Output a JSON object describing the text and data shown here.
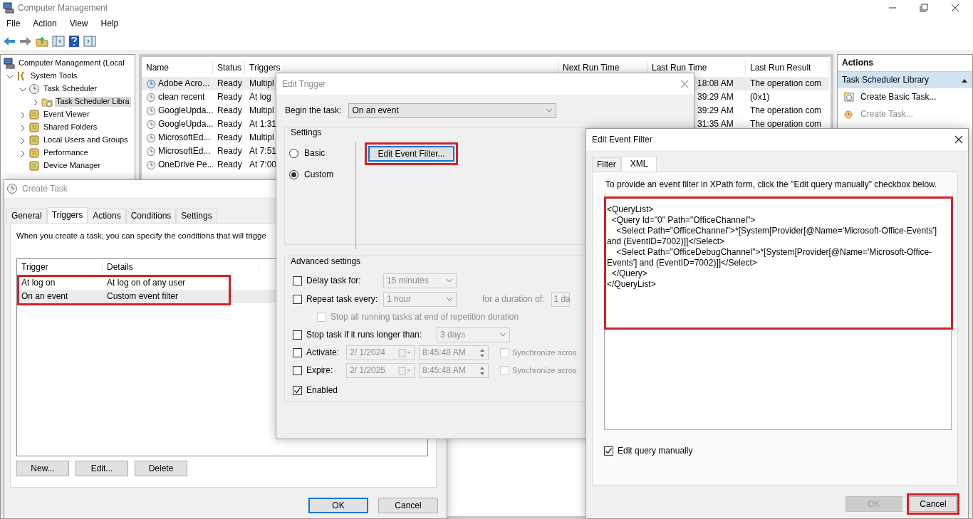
{
  "window": {
    "title": "Computer Management",
    "menu": [
      "File",
      "Action",
      "View",
      "Help"
    ]
  },
  "tree": [
    {
      "label": "Computer Management (Local",
      "selected": false,
      "children": [
        {
          "label": "System Tools",
          "expanded": true,
          "selected": false,
          "children": [
            {
              "label": "Task Scheduler",
              "expanded": true,
              "selected": false,
              "children": [
                {
                  "label": "Task Scheduler Libra",
                  "expanded": false,
                  "selected": true
                }
              ]
            },
            {
              "label": "Event Viewer",
              "expanded": false,
              "selected": false
            },
            {
              "label": "Shared Folders",
              "expanded": false,
              "selected": false
            },
            {
              "label": "Local Users and Groups",
              "expanded": false,
              "selected": false
            },
            {
              "label": "Performance",
              "expanded": false,
              "selected": false
            },
            {
              "label": "Device Manager",
              "selected": false
            }
          ]
        }
      ]
    }
  ],
  "task_list": {
    "columns": [
      "Name",
      "Status",
      "Triggers",
      "Next Run Time",
      "Last Run Time",
      "Last Run Result"
    ],
    "rows": [
      {
        "name": "Adobe Acro...",
        "status": "Ready",
        "triggers": "Multipl",
        "last_run_time": "18:08 AM",
        "last_run_result": "The operation com",
        "selected": true
      },
      {
        "name": "clean recent",
        "status": "Ready",
        "triggers": "At log",
        "last_run_time": "39:29 AM",
        "last_run_result": "(0x1)",
        "selected": false
      },
      {
        "name": "GoogleUpda...",
        "status": "Ready",
        "triggers": "Multipl",
        "last_run_time": "39:29 AM",
        "last_run_result": "The operation com",
        "selected": false
      },
      {
        "name": "GoogleUpda...",
        "status": "Ready",
        "triggers": "At 1:31",
        "last_run_time": "31:35 AM",
        "last_run_result": "The operation com",
        "selected": false
      },
      {
        "name": "MicrosoftEd...",
        "status": "Ready",
        "triggers": "Multipl",
        "selected": false
      },
      {
        "name": "MicrosoftEd...",
        "status": "Ready",
        "triggers": "At 7:51",
        "selected": false
      },
      {
        "name": "OneDrive Pe...",
        "status": "Ready",
        "triggers": "At 7:00",
        "selected": false
      }
    ]
  },
  "actions": {
    "title": "Actions",
    "section": {
      "label": "Task Scheduler Library",
      "expanded": true
    },
    "items": [
      {
        "label": "Create Basic Task...",
        "disabled": false
      },
      {
        "label": "Create Task...",
        "disabled": true
      }
    ]
  },
  "create_task": {
    "title": "Create Task",
    "tabs": [
      {
        "label": "General",
        "selected": false
      },
      {
        "label": "Triggers",
        "selected": true
      },
      {
        "label": "Actions",
        "selected": false
      },
      {
        "label": "Conditions",
        "selected": false
      },
      {
        "label": "Settings",
        "selected": false
      }
    ],
    "intro": "When you create a task, you can specify the conditions that will trigge",
    "columns": [
      "Trigger",
      "Details"
    ],
    "rows": [
      {
        "trigger": "At log on",
        "details": "At log on of any user",
        "selected": false
      },
      {
        "trigger": "On an event",
        "details": "Custom event filter",
        "selected": true
      }
    ],
    "rows_highlighted": true,
    "buttons": [
      "New...",
      "Edit...",
      "Delete"
    ],
    "footer_buttons": [
      {
        "label": "OK",
        "default": true
      },
      {
        "label": "Cancel",
        "default": false
      }
    ]
  },
  "edit_trigger": {
    "title": "Edit Trigger",
    "begin_label": "Begin the task:",
    "begin_value": "On an event",
    "settings_title": "Settings",
    "modes": [
      {
        "label": "Basic",
        "selected": false
      },
      {
        "label": "Custom",
        "selected": true
      }
    ],
    "filter_button": {
      "label": "Edit Event Filter...",
      "highlighted": true
    },
    "advanced_title": "Advanced settings",
    "delay": {
      "label": "Delay task for:",
      "checked": false,
      "value": "15 minutes"
    },
    "repeat": {
      "label": "Repeat task every:",
      "checked": false,
      "value": "1 hour",
      "duration_label": "for a duration of:",
      "duration_value": "1 da"
    },
    "stop_all": {
      "label": "Stop all running tasks at end of repetition duration",
      "checked": false,
      "disabled": true
    },
    "stop_longer": {
      "label": "Stop task if it runs longer than:",
      "checked": false,
      "value": "3 days"
    },
    "activate": {
      "label": "Activate:",
      "checked": false,
      "date": "2/  1/2024",
      "time": "8:45:48 AM",
      "sync_label": "Synchronize acros",
      "sync_checked": false
    },
    "expire": {
      "label": "Expire:",
      "checked": false,
      "date": "2/  1/2025",
      "time": "8:45:48 AM",
      "sync_label": "Synchronize acros",
      "sync_checked": false
    },
    "enabled": {
      "label": "Enabled",
      "checked": true
    }
  },
  "event_filter": {
    "title": "Edit Event Filter",
    "tabs": [
      {
        "label": "Filter",
        "selected": false
      },
      {
        "label": "XML",
        "selected": true
      }
    ],
    "hint": "To provide an event filter in XPath form, click the \"Edit query manually\" checkbox below.",
    "xml_lines": [
      "<QueryList>",
      "  <Query Id=\"0\" Path=\"OfficeChannel\">",
      "    <Select Path=\"OfficeChannel\">*[System[Provider[@Name='Microsoft-Office-Events'] and (EventID=7002)]]</Select>",
      "    <Select Path=\"OfficeDebugChannel\">*[System[Provider[@Name='Microsoft-Office-Events'] and (EventID=7002)]]</Select>",
      "  </Query>",
      "</QueryList>"
    ],
    "xml_highlighted": true,
    "manual": {
      "label": "Edit query manually",
      "checked": true
    },
    "buttons": [
      {
        "label": "OK",
        "disabled": true,
        "highlighted": false
      },
      {
        "label": "Cancel",
        "disabled": false,
        "highlighted": true
      }
    ]
  }
}
